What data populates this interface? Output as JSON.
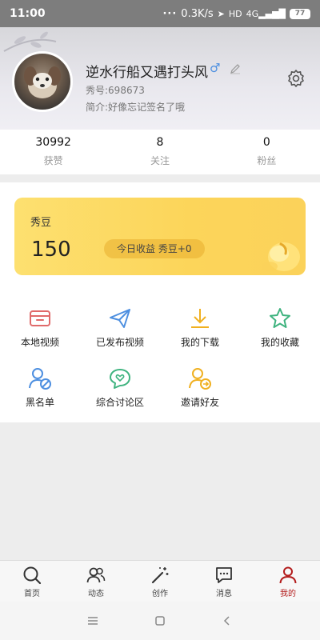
{
  "status_bar": {
    "time": "11:00",
    "speed": "0.3K/s",
    "hd": "HD",
    "network": "4G",
    "battery": "77"
  },
  "profile": {
    "name": "逆水行船又遇打头风",
    "gender_symbol": "♂",
    "id_text": "秀号:698673",
    "bio_text": "简介:好像忘记签名了哦"
  },
  "stats": [
    {
      "value": "30992",
      "label": "获赞"
    },
    {
      "value": "8",
      "label": "关注"
    },
    {
      "value": "0",
      "label": "粉丝"
    }
  ],
  "points": {
    "title": "秀豆",
    "value": "150",
    "today": "今日收益 秀豆+0"
  },
  "grid": [
    {
      "label": "本地视频",
      "icon": "folder-icon",
      "color": "#e06a6a"
    },
    {
      "label": "已发布视频",
      "icon": "paper-plane-icon",
      "color": "#4d8fe0"
    },
    {
      "label": "我的下载",
      "icon": "download-icon",
      "color": "#f0b020"
    },
    {
      "label": "我的收藏",
      "icon": "star-icon",
      "color": "#3fb37f"
    },
    {
      "label": "黑名单",
      "icon": "blocked-user-icon",
      "color": "#4d8fe0"
    },
    {
      "label": "综合讨论区",
      "icon": "chat-heart-icon",
      "color": "#3fb37f"
    },
    {
      "label": "邀请好友",
      "icon": "invite-user-icon",
      "color": "#f0b020"
    }
  ],
  "nav": [
    {
      "label": "首页",
      "icon": "search-icon"
    },
    {
      "label": "动态",
      "icon": "people-icon"
    },
    {
      "label": "创作",
      "icon": "magic-wand-icon"
    },
    {
      "label": "消息",
      "icon": "message-icon"
    },
    {
      "label": "我的",
      "icon": "user-icon",
      "active": true,
      "active_color": "#b31c1c"
    }
  ]
}
